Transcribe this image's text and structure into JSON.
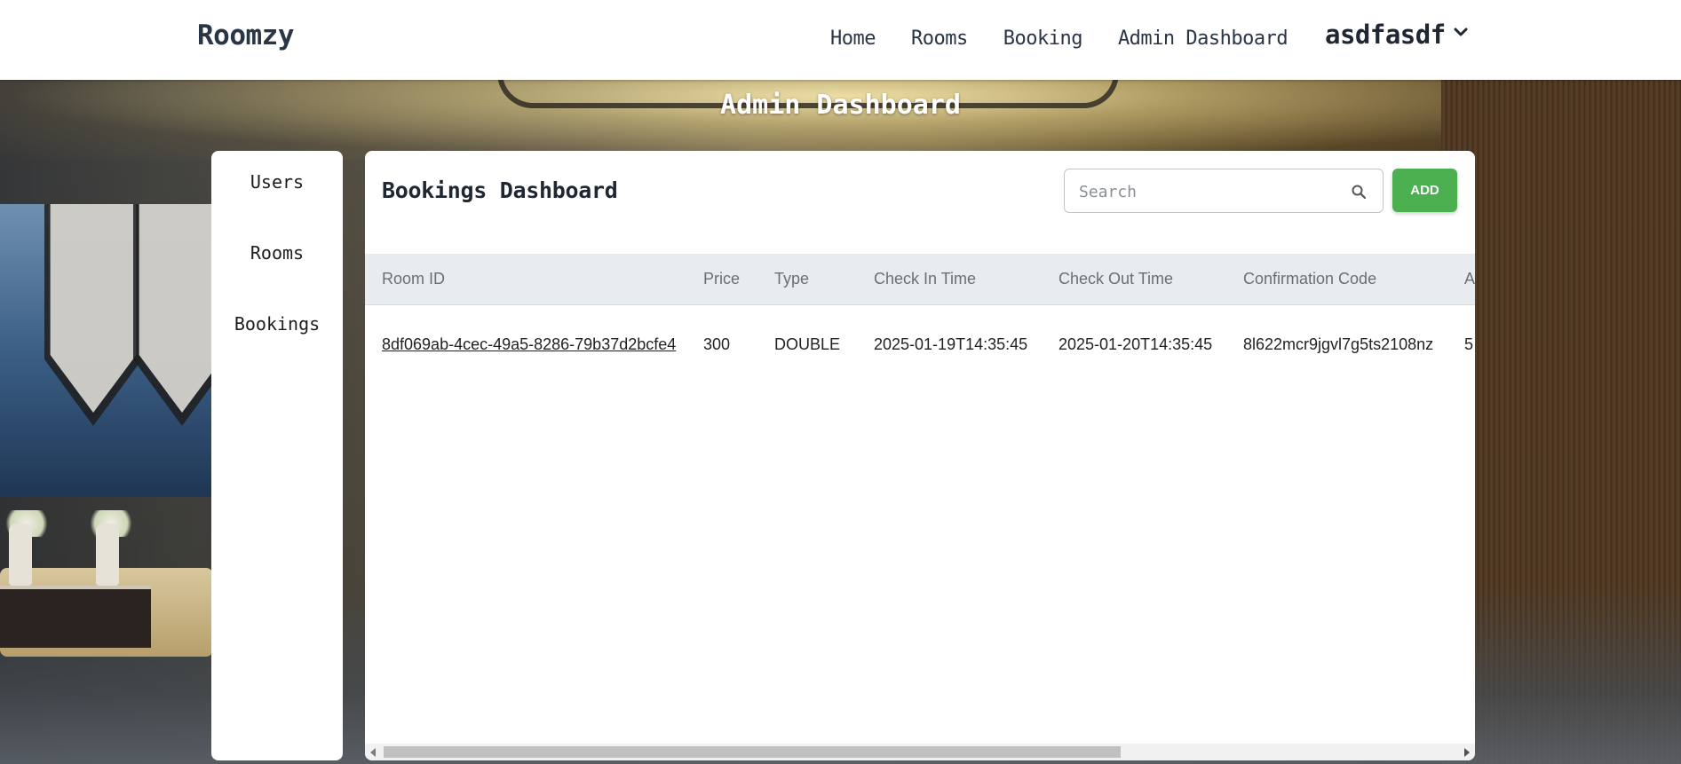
{
  "header": {
    "logo": "Roomzy",
    "nav": [
      "Home",
      "Rooms",
      "Booking",
      "Admin Dashboard"
    ],
    "user_name": "asdfasdf",
    "user_menu_icon": "chevron-down-icon"
  },
  "page": {
    "title": "Admin Dashboard"
  },
  "sidebar": {
    "items": [
      "Users",
      "Rooms",
      "Bookings"
    ]
  },
  "panel": {
    "title": "Bookings Dashboard",
    "search_placeholder": "Search",
    "search_icon": "search-icon",
    "add_label": "ADD"
  },
  "table": {
    "columns": [
      "Room ID",
      "Price",
      "Type",
      "Check In Time",
      "Check Out Time",
      "Confirmation Code",
      "A"
    ],
    "rows": [
      {
        "room_id": "8df069ab-4cec-49a5-8286-79b37d2bcfe4",
        "price": "300",
        "type": "DOUBLE",
        "check_in": "2025-01-19T14:35:45",
        "check_out": "2025-01-20T14:35:45",
        "confirmation_code": "8l622mcr9jgvl7g5ts2108nz",
        "extra": "5"
      }
    ]
  },
  "colors": {
    "accent_add_button": "#4caf50",
    "header_bg": "#ffffff",
    "table_header_bg": "#e9ecef"
  }
}
